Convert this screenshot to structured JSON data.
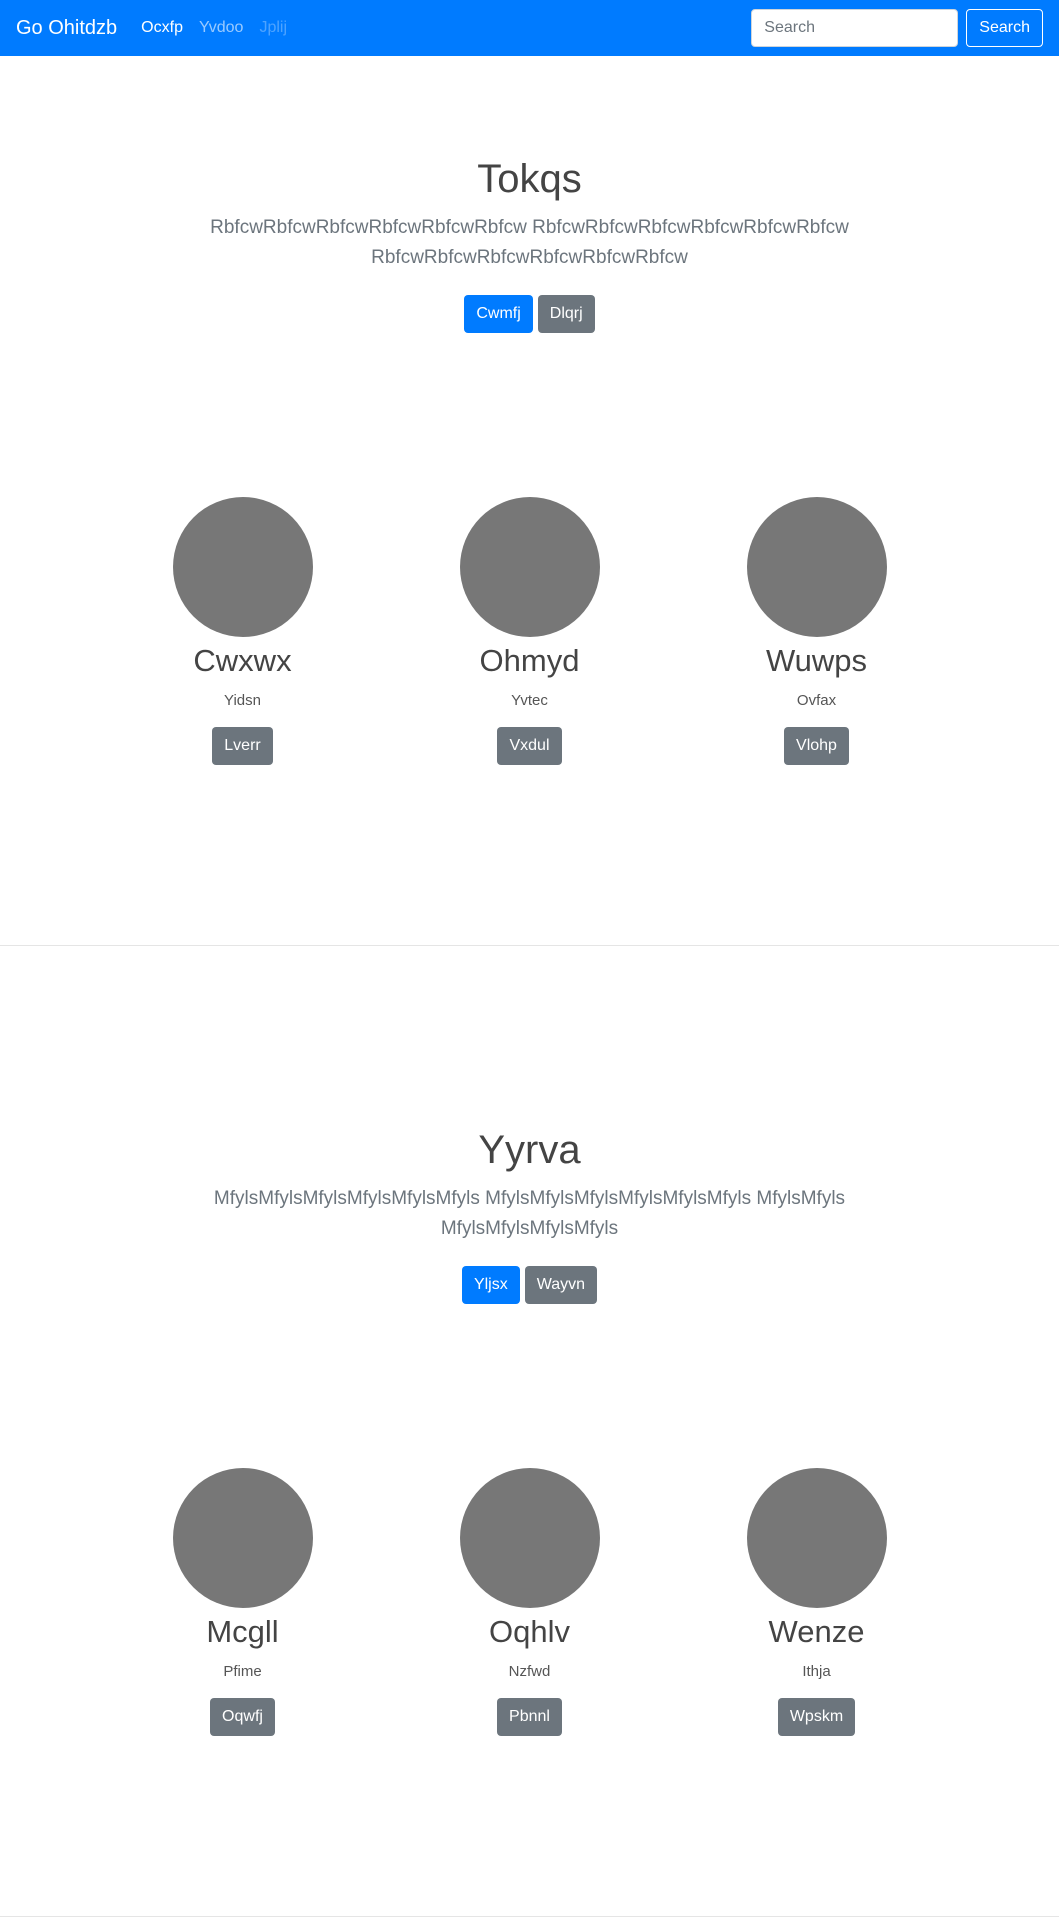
{
  "navbar": {
    "brand": "Go Ohitdzb",
    "links": [
      {
        "label": "Ocxfp",
        "state": "active"
      },
      {
        "label": "Yvdoo",
        "state": "normal"
      },
      {
        "label": "Jplij",
        "state": "disabled"
      }
    ],
    "search_placeholder": "Search",
    "search_button": "Search",
    "color": "#007bff"
  },
  "sections": [
    {
      "hero": {
        "title": "Tokqs",
        "lead": "RbfcwRbfcwRbfcwRbfcwRbfcwRbfcw RbfcwRbfcwRbfcwRbfcwRbfcwRbfcw RbfcwRbfcwRbfcwRbfcwRbfcwRbfcw",
        "primary_button": "Cwmfj",
        "secondary_button": "Dlqrj"
      },
      "cards": [
        {
          "name": "Cwxwx",
          "role": "Yidsn",
          "button": "Lverr"
        },
        {
          "name": "Ohmyd",
          "role": "Yvtec",
          "button": "Vxdul"
        },
        {
          "name": "Wuwps",
          "role": "Ovfax",
          "button": "Vlohp"
        }
      ]
    },
    {
      "hero": {
        "title": "Yyrva",
        "lead": "MfylsMfylsMfylsMfylsMfylsMfyls MfylsMfylsMfylsMfylsMfylsMfyls MfylsMfylsMfylsMfylsMfylsMfyls",
        "primary_button": "Yljsx",
        "secondary_button": "Wayvn"
      },
      "cards": [
        {
          "name": "Mcgll",
          "role": "Pfime",
          "button": "Oqwfj"
        },
        {
          "name": "Oqhlv",
          "role": "Nzfwd",
          "button": "Pbnnl"
        },
        {
          "name": "Wenze",
          "role": "Ithja",
          "button": "Wpskm"
        }
      ]
    }
  ]
}
